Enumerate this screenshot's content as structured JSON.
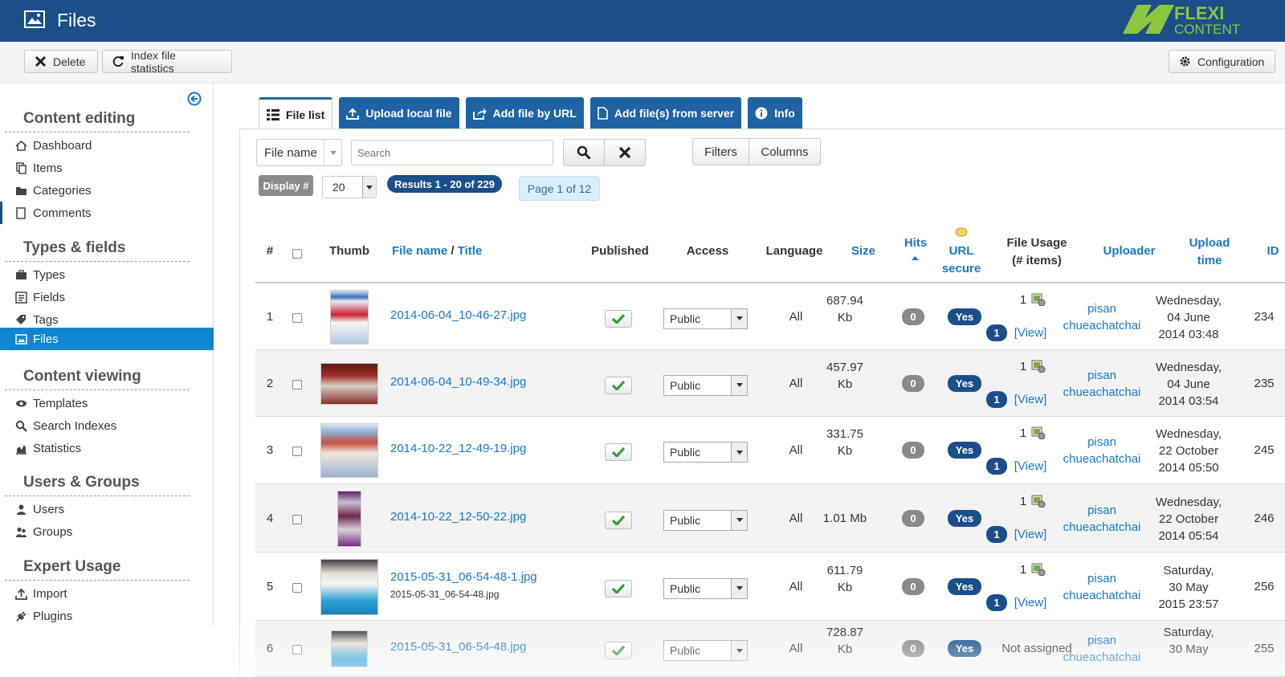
{
  "header": {
    "title": "Files",
    "logo_top": "FLEXI",
    "logo_bottom": "CONTENT"
  },
  "toolbar": {
    "delete": "Delete",
    "index_stats": "Index file statistics",
    "configuration": "Configuration"
  },
  "sidebar": {
    "sections": [
      {
        "title": "Content editing",
        "items": [
          "Dashboard",
          "Items",
          "Categories",
          "Comments"
        ]
      },
      {
        "title": "Types & fields",
        "items": [
          "Types",
          "Fields",
          "Tags",
          "Files"
        ]
      },
      {
        "title": "Content viewing",
        "items": [
          "Templates",
          "Search Indexes",
          "Statistics"
        ]
      },
      {
        "title": "Users & Groups",
        "items": [
          "Users",
          "Groups"
        ]
      },
      {
        "title": "Expert Usage",
        "items": [
          "Import",
          "Plugins"
        ]
      }
    ],
    "active_item": "Files"
  },
  "tabs": [
    "File list",
    "Upload local file",
    "Add file by URL",
    "Add file(s) from server",
    "Info"
  ],
  "filters": {
    "field_select": "File name",
    "search_placeholder": "Search",
    "filters_btn": "Filters",
    "columns_btn": "Columns",
    "display_label": "Display #",
    "display_value": "20",
    "results": "Results 1 - 20 of 229",
    "page": "Page 1 of 12"
  },
  "table": {
    "headers": {
      "num": "#",
      "thumb": "Thumb",
      "filename": "File name",
      "slash": "/",
      "title": "Title",
      "published": "Published",
      "access": "Access",
      "language": "Language",
      "size": "Size",
      "hits": "Hits",
      "url": "URL",
      "secure": "secure",
      "usage1": "File Usage",
      "usage2": "(# items)",
      "uploader": "Uploader",
      "upload1": "Upload",
      "upload2": "time",
      "id": "ID"
    },
    "rows": [
      {
        "num": "1",
        "name": "2014-06-04_10-46-27.jpg",
        "sub": "",
        "access": "Public",
        "lang": "All",
        "size1": "687.94",
        "size2": "Kb",
        "hits": "0",
        "secure": "Yes",
        "usage_count": "1",
        "usage_badge": "1",
        "usage_link": "[View]",
        "uploader1": "pisan",
        "uploader2": "chueachatchai",
        "day": "Wednesday,",
        "date": "04 June",
        "time": "2014 03:48",
        "id": "234"
      },
      {
        "num": "2",
        "name": "2014-06-04_10-49-34.jpg",
        "sub": "",
        "access": "Public",
        "lang": "All",
        "size1": "457.97",
        "size2": "Kb",
        "hits": "0",
        "secure": "Yes",
        "usage_count": "1",
        "usage_badge": "1",
        "usage_link": "[View]",
        "uploader1": "pisan",
        "uploader2": "chueachatchai",
        "day": "Wednesday,",
        "date": "04 June",
        "time": "2014 03:54",
        "id": "235"
      },
      {
        "num": "3",
        "name": "2014-10-22_12-49-19.jpg",
        "sub": "",
        "access": "Public",
        "lang": "All",
        "size1": "331.75",
        "size2": "Kb",
        "hits": "0",
        "secure": "Yes",
        "usage_count": "1",
        "usage_badge": "1",
        "usage_link": "[View]",
        "uploader1": "pisan",
        "uploader2": "chueachatchai",
        "day": "Wednesday,",
        "date": "22 October",
        "time": "2014 05:50",
        "id": "245"
      },
      {
        "num": "4",
        "name": "2014-10-22_12-50-22.jpg",
        "sub": "",
        "access": "Public",
        "lang": "All",
        "size1": "1.01 Mb",
        "size2": "",
        "hits": "0",
        "secure": "Yes",
        "usage_count": "1",
        "usage_badge": "1",
        "usage_link": "[View]",
        "uploader1": "pisan",
        "uploader2": "chueachatchai",
        "day": "Wednesday,",
        "date": "22 October",
        "time": "2014 05:54",
        "id": "246"
      },
      {
        "num": "5",
        "name": "2015-05-31_06-54-48-1.jpg",
        "sub": "2015-05-31_06-54-48.jpg",
        "access": "Public",
        "lang": "All",
        "size1": "611.79",
        "size2": "Kb",
        "hits": "0",
        "secure": "Yes",
        "usage_count": "1",
        "usage_badge": "1",
        "usage_link": "[View]",
        "uploader1": "pisan",
        "uploader2": "chueachatchai",
        "day": "Saturday,",
        "date": "30 May",
        "time": "2015 23:57",
        "id": "256"
      },
      {
        "num": "6",
        "name": "2015-05-31_06-54-48.jpg",
        "sub": "",
        "access": "Public",
        "lang": "All",
        "size1": "728.87",
        "size2": "Kb",
        "hits": "0",
        "secure": "Yes",
        "usage_text": "Not assigned",
        "uploader1": "pisan",
        "uploader2": "chueachatchai",
        "day": "Saturday,",
        "date": "30 May",
        "time": "",
        "id": "255"
      }
    ]
  },
  "colors": {
    "header": "#1b4f8a",
    "tab": "#1f63a4",
    "active": "#1086d0",
    "link": "#1978c8",
    "badge_dark": "#1b4f8a",
    "badge_gray": "#8a8a8a"
  }
}
